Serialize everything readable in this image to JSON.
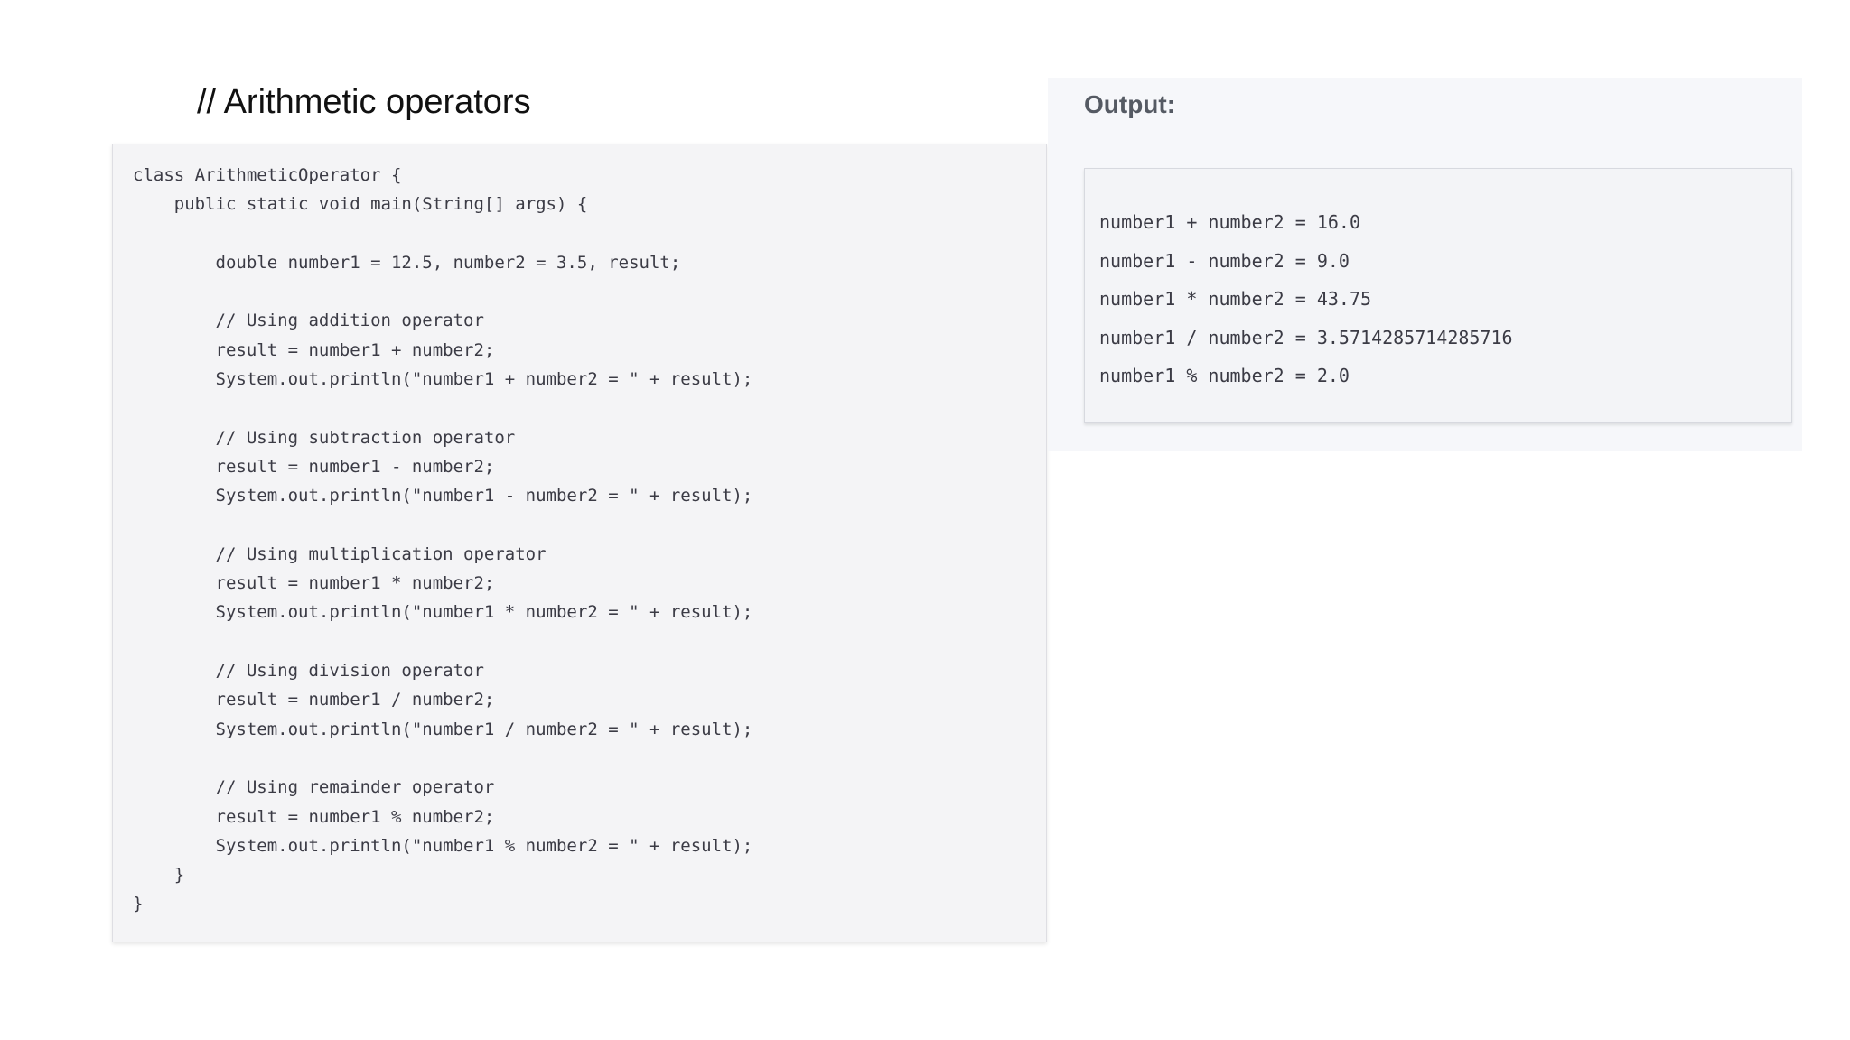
{
  "title": "// Arithmetic operators",
  "code": {
    "lines": [
      "class ArithmeticOperator {",
      "    public static void main(String[] args) {",
      "",
      "        double number1 = 12.5, number2 = 3.5, result;",
      "",
      "        // Using addition operator",
      "        result = number1 + number2;",
      "        System.out.println(\"number1 + number2 = \" + result);",
      "",
      "        // Using subtraction operator",
      "        result = number1 - number2;",
      "        System.out.println(\"number1 - number2 = \" + result);",
      "",
      "        // Using multiplication operator",
      "        result = number1 * number2;",
      "        System.out.println(\"number1 * number2 = \" + result);",
      "",
      "        // Using division operator",
      "        result = number1 / number2;",
      "        System.out.println(\"number1 / number2 = \" + result);",
      "",
      "        // Using remainder operator",
      "        result = number1 % number2;",
      "        System.out.println(\"number1 % number2 = \" + result);",
      "    }",
      "}"
    ]
  },
  "output": {
    "heading": "Output:",
    "lines": [
      "number1 + number2 = 16.0",
      "number1 - number2 = 9.0",
      "number1 * number2 = 43.75",
      "number1 / number2 = 3.5714285714285716",
      "number1 % number2 = 2.0"
    ]
  }
}
